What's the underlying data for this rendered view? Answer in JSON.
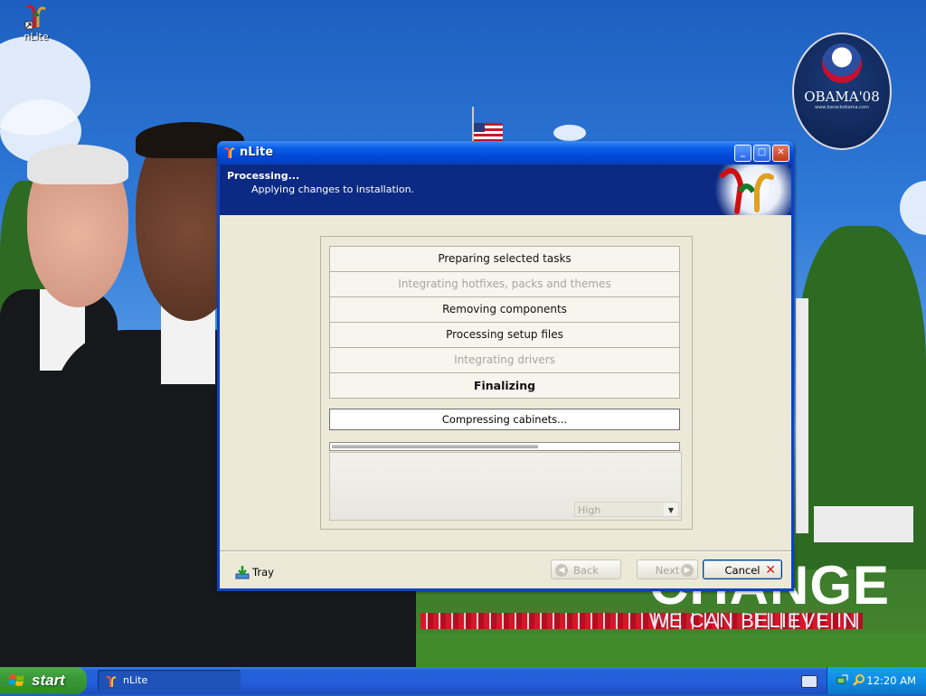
{
  "desktop": {
    "icon_label": "nLite",
    "badge": {
      "title": "OBAMA'08",
      "url": "www.barackobama.com"
    },
    "slogan": {
      "big": "CHANGE",
      "sub": "WE CAN BELIEVE IN"
    }
  },
  "window": {
    "title": "nLite",
    "header": {
      "title": "Processing...",
      "subtitle": "Applying changes to installation."
    },
    "steps": [
      {
        "label": "Preparing selected tasks",
        "state": "done"
      },
      {
        "label": "Integrating hotfixes, packs and themes",
        "state": "skipped"
      },
      {
        "label": "Removing components",
        "state": "done"
      },
      {
        "label": "Processing setup files",
        "state": "done"
      },
      {
        "label": "Integrating drivers",
        "state": "skipped"
      },
      {
        "label": "Finalizing",
        "state": "active"
      }
    ],
    "status_text": "Compressing cabinets...",
    "progress": 0.6,
    "priority": {
      "selected": "High"
    },
    "buttons": {
      "tray": "Tray",
      "back": "Back",
      "next": "Next",
      "cancel": "Cancel"
    }
  },
  "taskbar": {
    "start_label": "start",
    "items": [
      {
        "label": "nLite"
      }
    ],
    "clock": "12:20 AM"
  },
  "colors": {
    "title_bar": "#0046d5",
    "header_bg": "#0c2a83",
    "dialog_bg": "#ece9d8",
    "start_green": "#3a9a36",
    "taskbar_blue": "#245edb"
  }
}
